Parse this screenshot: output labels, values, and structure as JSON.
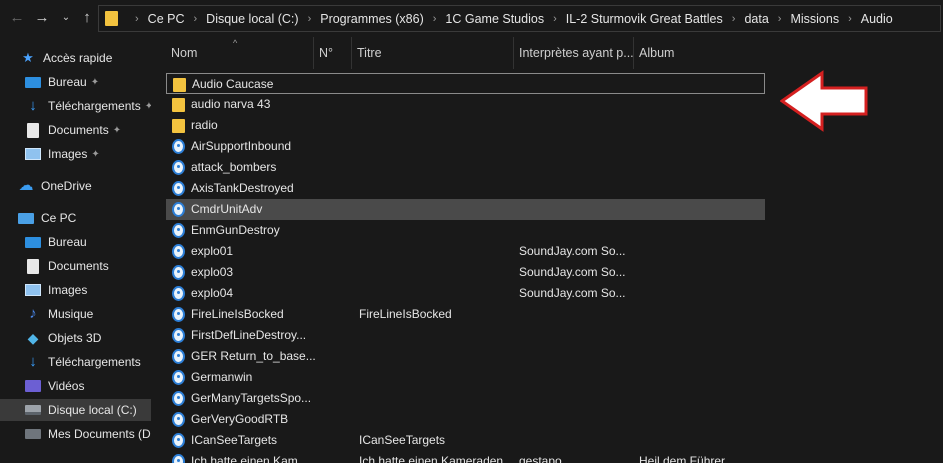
{
  "nav": {
    "back_icon": "arrow-left-icon",
    "forward_icon": "arrow-right-icon",
    "recent_icon": "chevron-down-icon",
    "up_icon": "arrow-up-icon"
  },
  "breadcrumbs": [
    "Ce PC",
    "Disque local (C:)",
    "Programmes (x86)",
    "1C Game Studios",
    "IL-2 Sturmovik Great Battles",
    "data",
    "Missions",
    "Audio"
  ],
  "sidebar": {
    "items": [
      {
        "label": "Accès rapide",
        "icon": "star-icon",
        "pinned": false
      },
      {
        "label": "Bureau",
        "icon": "desktop-icon",
        "pinned": true
      },
      {
        "label": "Téléchargements",
        "icon": "download-icon",
        "pinned": true
      },
      {
        "label": "Documents",
        "icon": "document-icon",
        "pinned": true
      },
      {
        "label": "Images",
        "icon": "images-icon",
        "pinned": true
      },
      {
        "label": "OneDrive",
        "icon": "cloud-icon",
        "pinned": false
      },
      {
        "label": "Ce PC",
        "icon": "computer-icon",
        "pinned": false
      },
      {
        "label": "Bureau",
        "icon": "desktop-icon",
        "pinned": false
      },
      {
        "label": "Documents",
        "icon": "document-icon",
        "pinned": false
      },
      {
        "label": "Images",
        "icon": "images-icon",
        "pinned": false
      },
      {
        "label": "Musique",
        "icon": "music-icon",
        "pinned": false
      },
      {
        "label": "Objets 3D",
        "icon": "cube-icon",
        "pinned": false
      },
      {
        "label": "Téléchargements",
        "icon": "download-icon",
        "pinned": false
      },
      {
        "label": "Vidéos",
        "icon": "video-icon",
        "pinned": false
      },
      {
        "label": "Disque local (C:)",
        "icon": "drive-icon",
        "pinned": false,
        "selected": true
      },
      {
        "label": "Mes Documents (D:",
        "icon": "drive-icon",
        "pinned": false
      }
    ]
  },
  "columns": {
    "name": "Nom",
    "number": "N°",
    "title": "Titre",
    "artists": "Interprètes ayant p...",
    "album": "Album"
  },
  "files": [
    {
      "name": "Audio Caucase",
      "type": "folder",
      "title": "",
      "artists": "",
      "album": "",
      "focused": true
    },
    {
      "name": "audio narva 43",
      "type": "folder",
      "title": "",
      "artists": "",
      "album": ""
    },
    {
      "name": "radio",
      "type": "folder",
      "title": "",
      "artists": "",
      "album": ""
    },
    {
      "name": "AirSupportInbound",
      "type": "audio",
      "title": "",
      "artists": "",
      "album": ""
    },
    {
      "name": "attack_bombers",
      "type": "audio",
      "title": "",
      "artists": "",
      "album": ""
    },
    {
      "name": "AxisTankDestroyed",
      "type": "audio",
      "title": "",
      "artists": "",
      "album": ""
    },
    {
      "name": "CmdrUnitAdv",
      "type": "audio",
      "title": "",
      "artists": "",
      "album": "",
      "selected": true
    },
    {
      "name": "EnmGunDestroy",
      "type": "audio",
      "title": "",
      "artists": "",
      "album": ""
    },
    {
      "name": "explo01",
      "type": "audio",
      "title": "",
      "artists": "SoundJay.com So...",
      "album": ""
    },
    {
      "name": "explo03",
      "type": "audio",
      "title": "",
      "artists": "SoundJay.com So...",
      "album": ""
    },
    {
      "name": "explo04",
      "type": "audio",
      "title": "",
      "artists": "SoundJay.com So...",
      "album": ""
    },
    {
      "name": "FireLineIsBocked",
      "type": "audio",
      "title": "FireLineIsBocked",
      "artists": "",
      "album": ""
    },
    {
      "name": "FirstDefLineDestroy...",
      "type": "audio",
      "title": "",
      "artists": "",
      "album": ""
    },
    {
      "name": "GER Return_to_base...",
      "type": "audio",
      "title": "",
      "artists": "",
      "album": ""
    },
    {
      "name": "Germanwin",
      "type": "audio",
      "title": "",
      "artists": "",
      "album": ""
    },
    {
      "name": "GerManyTargetsSpo...",
      "type": "audio",
      "title": "",
      "artists": "",
      "album": ""
    },
    {
      "name": "GerVeryGoodRTB",
      "type": "audio",
      "title": "",
      "artists": "",
      "album": ""
    },
    {
      "name": "ICanSeeTargets",
      "type": "audio",
      "title": "ICanSeeTargets",
      "artists": "",
      "album": ""
    },
    {
      "name": "Ich hatte einen Kam...",
      "type": "audio",
      "title": "Ich hatte einen Kameraden",
      "artists": "gestapo",
      "album": "Heil dem Führer"
    }
  ],
  "colors": {
    "background": "#191919",
    "selection": "#4a4a4a",
    "folder": "#f3c33f",
    "accent": "#2c7ed6",
    "annotation_arrow": "#d42020"
  },
  "annotation": {
    "icon": "red-arrow-left-icon"
  }
}
